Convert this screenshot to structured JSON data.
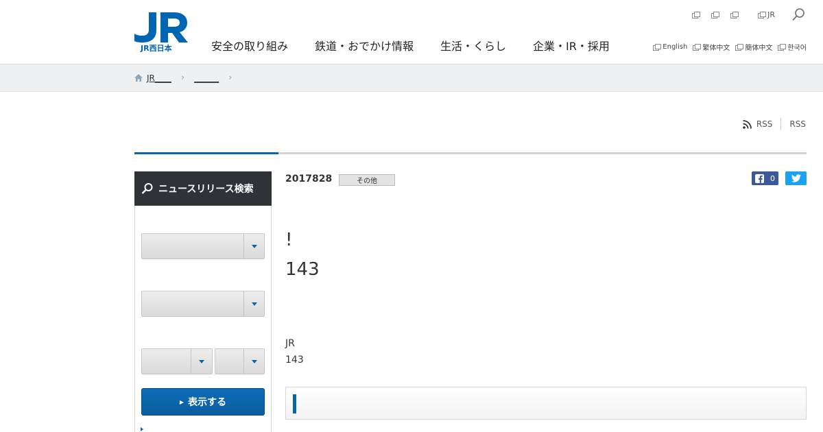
{
  "logo": {
    "text": "JR西日本"
  },
  "global_nav": [
    {
      "label": "安全の取り組み"
    },
    {
      "label": "鉄道・おでかけ情報"
    },
    {
      "label": "生活・くらし"
    },
    {
      "label": "企業・IR・採用"
    }
  ],
  "utility_links": [
    {
      "label": ""
    },
    {
      "label": ""
    },
    {
      "label": ""
    },
    {
      "label": "JR"
    }
  ],
  "languages": [
    {
      "label": "English"
    },
    {
      "label": "繁体中文"
    },
    {
      "label": "簡体中文"
    },
    {
      "label": "한국어"
    }
  ],
  "breadcrumb": [
    {
      "label": "JR____"
    },
    {
      "label": "______"
    }
  ],
  "rss": [
    {
      "label": "RSS"
    },
    {
      "label": "RSS"
    }
  ],
  "sidebar": {
    "title": "ニュースリリース検索",
    "show_button": "表示する"
  },
  "article": {
    "date": "2017828",
    "category": "その他",
    "title_line1": "!",
    "title_line2": "143",
    "body_line1": "JR",
    "body_line2": "143"
  },
  "share": {
    "facebook_count": "0"
  },
  "colors": {
    "brand_blue": "#0a64a8",
    "sidebar_head": "#2f3338",
    "facebook": "#3b5998",
    "twitter": "#1da1f2"
  }
}
